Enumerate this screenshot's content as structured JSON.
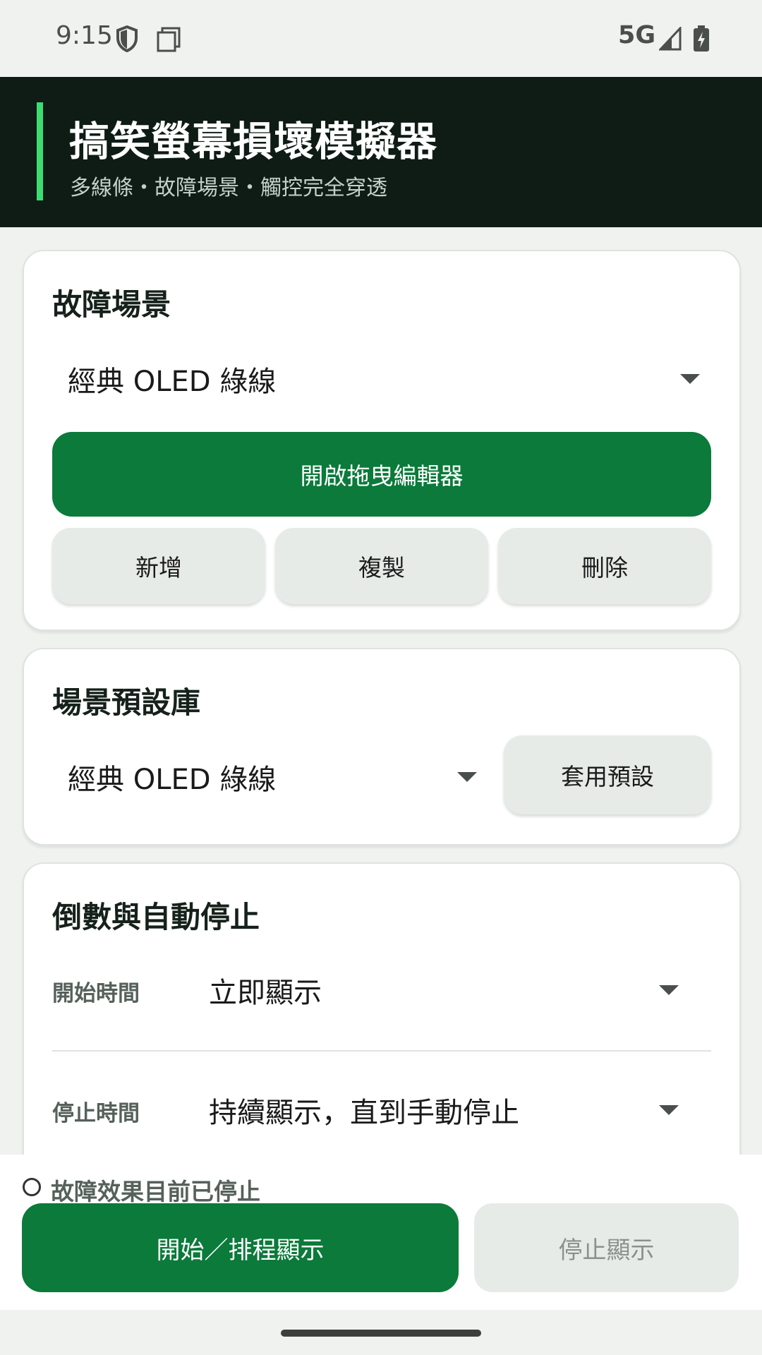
{
  "status_bar": {
    "time": "9:15",
    "network": "5G",
    "icons": [
      "shield-icon",
      "screen-icon",
      "signal-icon",
      "battery-icon"
    ]
  },
  "header": {
    "title": "搞笑螢幕損壞模擬器",
    "subtitle": "多線條・故障場景・觸控完全穿透",
    "accent_color": "#3ddc72",
    "background_color": "#0f1c16"
  },
  "scene_card": {
    "title": "故障場景",
    "selected_scene": "經典 OLED 綠線",
    "open_editor_label": "開啟拖曳編輯器",
    "add_label": "新增",
    "copy_label": "複製",
    "delete_label": "刪除"
  },
  "preset_card": {
    "title": "場景預設庫",
    "selected_preset": "經典 OLED 綠線",
    "apply_label": "套用預設"
  },
  "timer_card": {
    "title": "倒數與自動停止",
    "start_label": "開始時間",
    "start_value": "立即顯示",
    "stop_label": "停止時間",
    "stop_value": "持續顯示，直到手動停止"
  },
  "bottom_panel": {
    "status_text": "故障效果目前已停止",
    "start_button_label": "開始／排程顯示",
    "stop_button_label": "停止顯示"
  },
  "colors": {
    "primary_green": "#0b7a3a",
    "secondary_grey": "#e6ebe8"
  }
}
